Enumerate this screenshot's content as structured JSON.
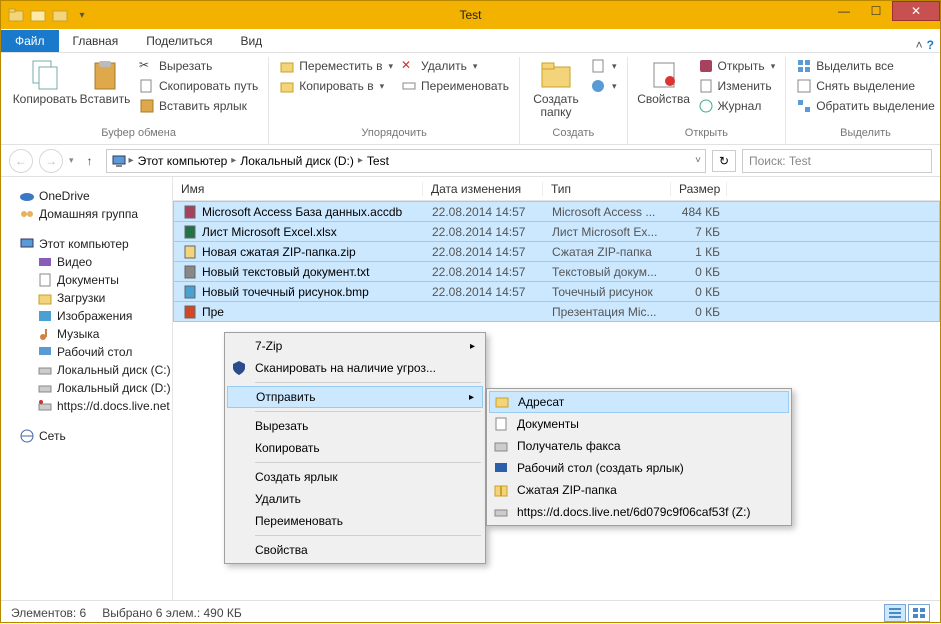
{
  "window": {
    "title": "Test"
  },
  "tabs": {
    "file": "Файл",
    "home": "Главная",
    "share": "Поделиться",
    "view": "Вид"
  },
  "ribbon": {
    "clipboard": {
      "label": "Буфер обмена",
      "copy": "Копировать",
      "paste": "Вставить",
      "cut": "Вырезать",
      "copy_path": "Скопировать путь",
      "paste_shortcut": "Вставить ярлык"
    },
    "organize": {
      "label": "Упорядочить",
      "move_to": "Переместить в",
      "copy_to": "Копировать в",
      "delete": "Удалить",
      "rename": "Переименовать"
    },
    "create": {
      "label": "Создать",
      "new_folder": "Создать папку"
    },
    "open": {
      "label": "Открыть",
      "properties": "Свойства",
      "open": "Открыть",
      "edit": "Изменить",
      "history": "Журнал"
    },
    "select": {
      "label": "Выделить",
      "select_all": "Выделить все",
      "select_none": "Снять выделение",
      "invert": "Обратить выделение"
    }
  },
  "breadcrumb": [
    "Этот компьютер",
    "Локальный диск (D:)",
    "Test"
  ],
  "search_placeholder": "Поиск: Test",
  "sidebar": {
    "onedrive": "OneDrive",
    "homegroup": "Домашняя группа",
    "this_pc": "Этот компьютер",
    "videos": "Видео",
    "documents": "Документы",
    "downloads": "Загрузки",
    "pictures": "Изображения",
    "music": "Музыка",
    "desktop": "Рабочий стол",
    "disk_c": "Локальный диск (C:)",
    "disk_d": "Локальный диск (D:)",
    "docs_live": "https://d.docs.live.net",
    "network": "Сеть"
  },
  "columns": {
    "name": "Имя",
    "date": "Дата изменения",
    "type": "Тип",
    "size": "Размер"
  },
  "files": [
    {
      "name": "Microsoft Access База данных.accdb",
      "date": "22.08.2014 14:57",
      "type": "Microsoft Access ...",
      "size": "484 КБ"
    },
    {
      "name": "Лист Microsoft Excel.xlsx",
      "date": "22.08.2014 14:57",
      "type": "Лист Microsoft Ex...",
      "size": "7 КБ"
    },
    {
      "name": "Новая сжатая ZIP-папка.zip",
      "date": "22.08.2014 14:57",
      "type": "Сжатая ZIP-папка",
      "size": "1 КБ"
    },
    {
      "name": "Новый текстовый документ.txt",
      "date": "22.08.2014 14:57",
      "type": "Текстовый докум...",
      "size": "0 КБ"
    },
    {
      "name": "Новый точечный рисунок.bmp",
      "date": "22.08.2014 14:57",
      "type": "Точечный рисунок",
      "size": "0 КБ"
    },
    {
      "name": "Пре",
      "date": "",
      "type": "Презентация Mic...",
      "size": "0 КБ"
    }
  ],
  "context_menu": {
    "seven_zip": "7-Zip",
    "scan": "Сканировать на наличие угроз...",
    "send_to": "Отправить",
    "cut": "Вырезать",
    "copy": "Копировать",
    "shortcut": "Создать ярлык",
    "delete": "Удалить",
    "rename": "Переименовать",
    "properties": "Свойства"
  },
  "send_menu": {
    "recipient": "Адресат",
    "documents": "Документы",
    "fax": "Получатель факса",
    "desktop": "Рабочий стол (создать ярлык)",
    "zip": "Сжатая ZIP-папка",
    "docs_live": "https://d.docs.live.net/6d079c9f06caf53f (Z:)"
  },
  "status": {
    "items": "Элементов: 6",
    "selected": "Выбрано 6 элем.: 490 КБ"
  }
}
